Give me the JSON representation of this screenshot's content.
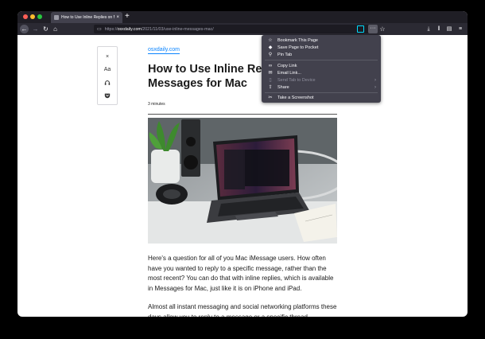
{
  "tab": {
    "title": "How to Use Inline Replies on Messages for Mac",
    "close": "×"
  },
  "newtab": "+",
  "nav": {
    "back": "←",
    "forward": "→",
    "reload": "↻",
    "home": "⌂",
    "more": "···",
    "star": "☆"
  },
  "url": {
    "prefix": "https://",
    "host": "osxdaily.com",
    "path": "/2021/11/03/use-inline-messages-mac/"
  },
  "reader_toolbar": {
    "close": "×",
    "type": "Aa",
    "listen": "🎧",
    "pocket": "◆"
  },
  "article": {
    "site": "osxdaily.com",
    "title": "How to Use Inline Replies on Messages for Mac",
    "read_time": "3 minutes",
    "para1": "Here's a question for all of you Mac iMessage users. How often have you wanted to reply to a specific message, rather than the most recent? You can do that with inline replies, which is available in Messages for Mac, just like it is on iPhone and iPad.",
    "para2": "Almost all instant messaging and social networking platforms these days allow you to reply to a message or a specific thread."
  },
  "menu": {
    "items": [
      {
        "label": "Bookmark This Page",
        "icon": "star-icon",
        "glyph": "☆"
      },
      {
        "label": "Save Page to Pocket",
        "icon": "pocket-icon",
        "glyph": "◆"
      },
      {
        "label": "Pin Tab",
        "icon": "pin-icon",
        "glyph": "⚲"
      },
      {
        "label": "Copy Link",
        "icon": "link-icon",
        "glyph": "∞"
      },
      {
        "label": "Email Link...",
        "icon": "mail-icon",
        "glyph": "✉"
      },
      {
        "label": "Send Tab to Device",
        "icon": "device-icon",
        "glyph": "▯",
        "disabled": true,
        "arrow": "›"
      },
      {
        "label": "Share",
        "icon": "share-icon",
        "glyph": "⇪",
        "arrow": "›"
      },
      {
        "label": "Take a Screenshot",
        "icon": "screenshot-icon",
        "glyph": "✂"
      }
    ]
  },
  "colors": {
    "accent": "#0a84ff",
    "chrome": "#2b2a33",
    "menu": "#42414d"
  }
}
